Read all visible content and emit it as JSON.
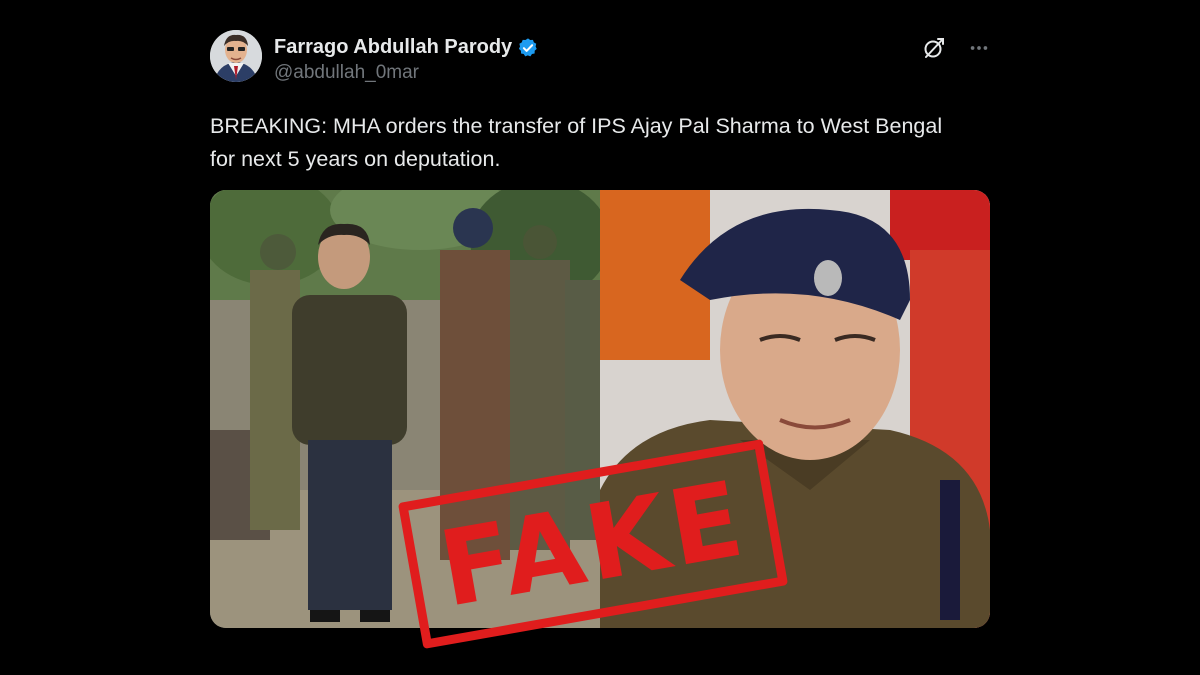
{
  "tweet": {
    "display_name": "Farrago Abdullah Parody",
    "handle": "@abdullah_0mar",
    "text": "BREAKING: MHA orders the transfer of IPS Ajay Pal Sharma to West Bengal for next 5 years on deputation.",
    "icons": {
      "verified": "verified-badge-icon",
      "grok": "grok-icon",
      "more": "more-options-icon"
    },
    "colors": {
      "verified": "#1d9bf0",
      "text": "#e7e9ea",
      "muted": "#71767b",
      "background": "#000000"
    }
  },
  "overlay": {
    "stamp_text": "FAKE",
    "stamp_color": "#e01d1d"
  }
}
